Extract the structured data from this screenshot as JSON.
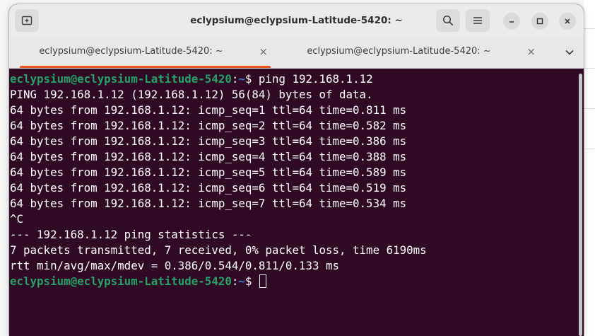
{
  "window": {
    "title": "eclypsium@eclypsium-Latitude-5420: ~",
    "buttons": {
      "new_tab_icon": "new-tab-icon",
      "search_icon": "search-icon",
      "menu_icon": "hamburger-menu-icon",
      "minimize_icon": "minimize-icon",
      "maximize_icon": "maximize-icon",
      "close_icon": "close-icon"
    }
  },
  "tabs": [
    {
      "label": "eclypsium@eclypsium-Latitude-5420: ~",
      "close": "×",
      "active": true
    },
    {
      "label": "eclypsium@eclypsium-Latitude-5420: ~",
      "close": "×",
      "active": false
    }
  ],
  "prompt": {
    "user_host": "eclypsium@eclypsium-Latitude-5420",
    "colon": ":",
    "path": "~",
    "symbol": "$ "
  },
  "terminal": {
    "command": "ping 192.168.1.12",
    "output": [
      "PING 192.168.1.12 (192.168.1.12) 56(84) bytes of data.",
      "64 bytes from 192.168.1.12: icmp_seq=1 ttl=64 time=0.811 ms",
      "64 bytes from 192.168.1.12: icmp_seq=2 ttl=64 time=0.582 ms",
      "64 bytes from 192.168.1.12: icmp_seq=3 ttl=64 time=0.386 ms",
      "64 bytes from 192.168.1.12: icmp_seq=4 ttl=64 time=0.388 ms",
      "64 bytes from 192.168.1.12: icmp_seq=5 ttl=64 time=0.589 ms",
      "64 bytes from 192.168.1.12: icmp_seq=6 ttl=64 time=0.519 ms",
      "64 bytes from 192.168.1.12: icmp_seq=7 ttl=64 time=0.534 ms",
      "^C",
      "--- 192.168.1.12 ping statistics ---",
      "7 packets transmitted, 7 received, 0% packet loss, time 6190ms",
      "rtt min/avg/max/mdev = 0.386/0.544/0.811/0.133 ms"
    ]
  },
  "colors": {
    "terminal_bg": "#300a24",
    "prompt_user": "#26a269",
    "prompt_path": "#3d7dd0",
    "tab_accent": "#e95420"
  }
}
